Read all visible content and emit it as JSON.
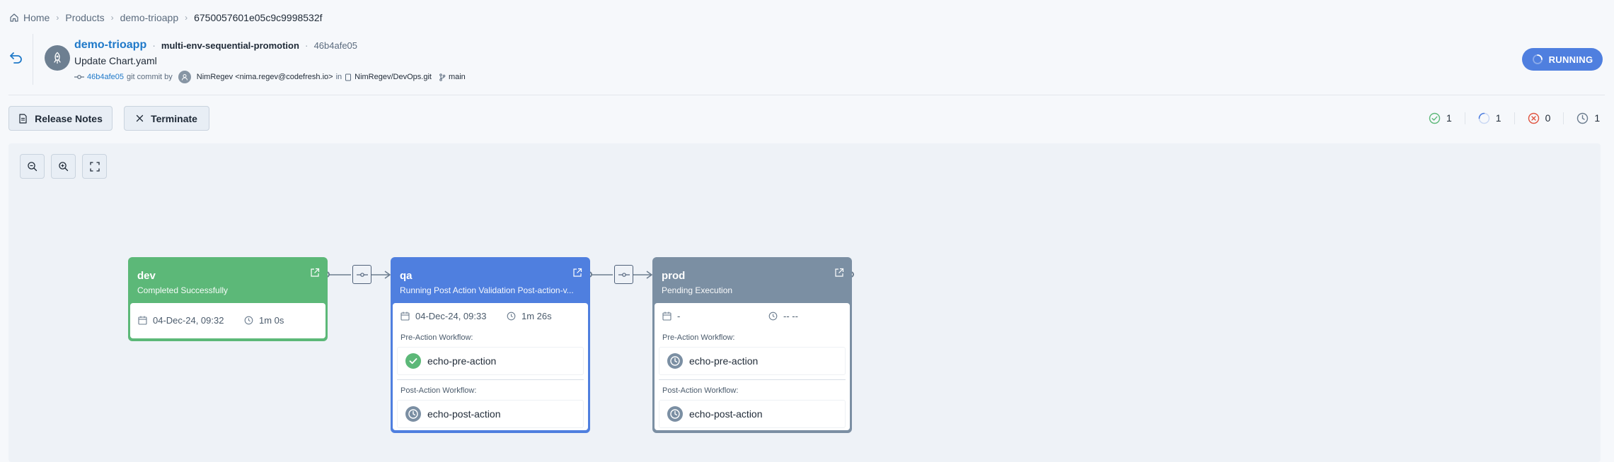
{
  "breadcrumb": {
    "home": "Home",
    "products": "Products",
    "product": "demo-trioapp",
    "promotion_id": "6750057601e05c9c9998532f"
  },
  "header": {
    "app_name": "demo-trioapp",
    "promotion_name": "multi-env-sequential-promotion",
    "short_sha": "46b4afe05",
    "commit_message": "Update Chart.yaml",
    "commit_sha": "46b4afe05",
    "commit_type": "git commit by",
    "author": "NimRegev <nima.regev@codefresh.io>",
    "in_label": "in",
    "repo": "NimRegev/DevOps.git",
    "branch": "main",
    "status": "RUNNING"
  },
  "actions": {
    "release_notes": "Release Notes",
    "terminate": "Terminate"
  },
  "stats": {
    "succeeded": "1",
    "running": "1",
    "failed": "0",
    "pending": "1"
  },
  "environments": [
    {
      "name": "dev",
      "status": "Completed Successfully",
      "date": "04-Dec-24, 09:32",
      "duration": "1m 0s",
      "color": "#5cb878"
    },
    {
      "name": "qa",
      "status": "Running Post Action Validation Post-action-v...",
      "date": "04-Dec-24, 09:33",
      "duration": "1m 26s",
      "color": "#4f7fdf",
      "pre_label": "Pre-Action Workflow:",
      "pre_workflow": "echo-pre-action",
      "post_label": "Post-Action Workflow:",
      "post_workflow": "echo-post-action"
    },
    {
      "name": "prod",
      "status": "Pending Execution",
      "date": "-",
      "duration": "-- --",
      "color": "#7b8fa3",
      "pre_label": "Pre-Action Workflow:",
      "pre_workflow": "echo-pre-action",
      "post_label": "Post-Action Workflow:",
      "post_workflow": "echo-post-action"
    }
  ],
  "colors": {
    "link": "#1f79c9",
    "success": "#5cb878",
    "running": "#4f7fdf",
    "pending": "#7b8fa3",
    "failed": "#e0533f"
  }
}
